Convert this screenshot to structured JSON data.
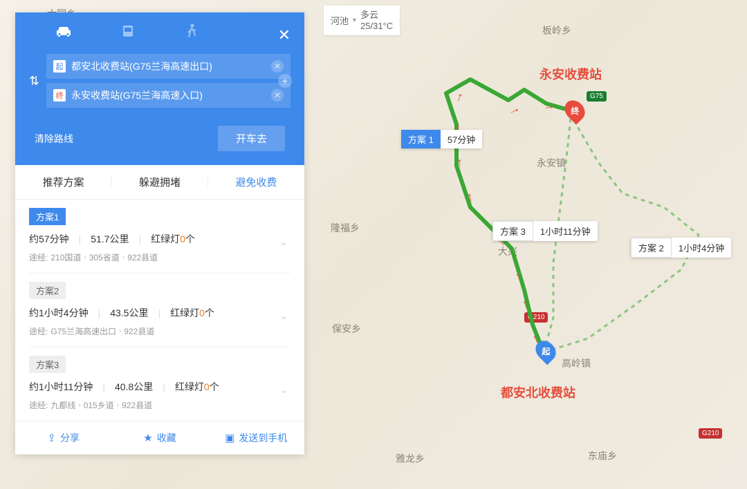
{
  "weather": {
    "city": "河池",
    "condition": "多云",
    "temp": "25/31°C"
  },
  "annotations": {
    "end_label": "永安收费站",
    "start_label": "都安北收费站"
  },
  "markers": {
    "start": "起",
    "end": "终"
  },
  "map_tags": {
    "plan1": {
      "label": "方案 1",
      "time": "57分钟"
    },
    "plan2": {
      "label": "方案 2",
      "time": "1小时4分钟"
    },
    "plan3": {
      "label": "方案 3",
      "time": "1小时11分钟"
    }
  },
  "map_labels": {
    "datong": "大同乡",
    "banling": "板岭乡",
    "yongan": "永安镇",
    "longfu": "隆福乡",
    "daxing": "大兴",
    "baoan": "保安乡",
    "gaoling": "高岭镇",
    "dongmiao": "东庙乡",
    "yalong": "雅龙乡"
  },
  "shields": {
    "g75": "G75",
    "g210": "G210"
  },
  "panel": {
    "start_badge": "起",
    "end_badge": "终",
    "start_text": "都安北收费站(G75兰海高速出口)",
    "end_text": "永安收费站(G75兰海高速入口)",
    "clear": "清除路线",
    "drive": "开车去",
    "filters": {
      "rec": "推荐方案",
      "avoid_congest": "躲避拥堵",
      "avoid_toll": "避免收费"
    },
    "routes": [
      {
        "name": "方案1",
        "time": "约57分钟",
        "dist": "51.7公里",
        "lights_label": "红绿灯",
        "lights_count": "0",
        "lights_suffix": "个",
        "via_label": "途经:",
        "via": [
          "210国道",
          "305省道",
          "922县道"
        ]
      },
      {
        "name": "方案2",
        "time": "约1小时4分钟",
        "dist": "43.5公里",
        "lights_label": "红绿灯",
        "lights_count": "0",
        "lights_suffix": "个",
        "via_label": "途经:",
        "via": [
          "G75兰海高速出口",
          "922县道"
        ]
      },
      {
        "name": "方案3",
        "time": "约1小时11分钟",
        "dist": "40.8公里",
        "lights_label": "红绿灯",
        "lights_count": "0",
        "lights_suffix": "个",
        "via_label": "途经:",
        "via": [
          "九都线",
          "015乡道",
          "922县道"
        ]
      }
    ],
    "footer": {
      "share": "分享",
      "fav": "收藏",
      "send": "发送到手机"
    }
  }
}
